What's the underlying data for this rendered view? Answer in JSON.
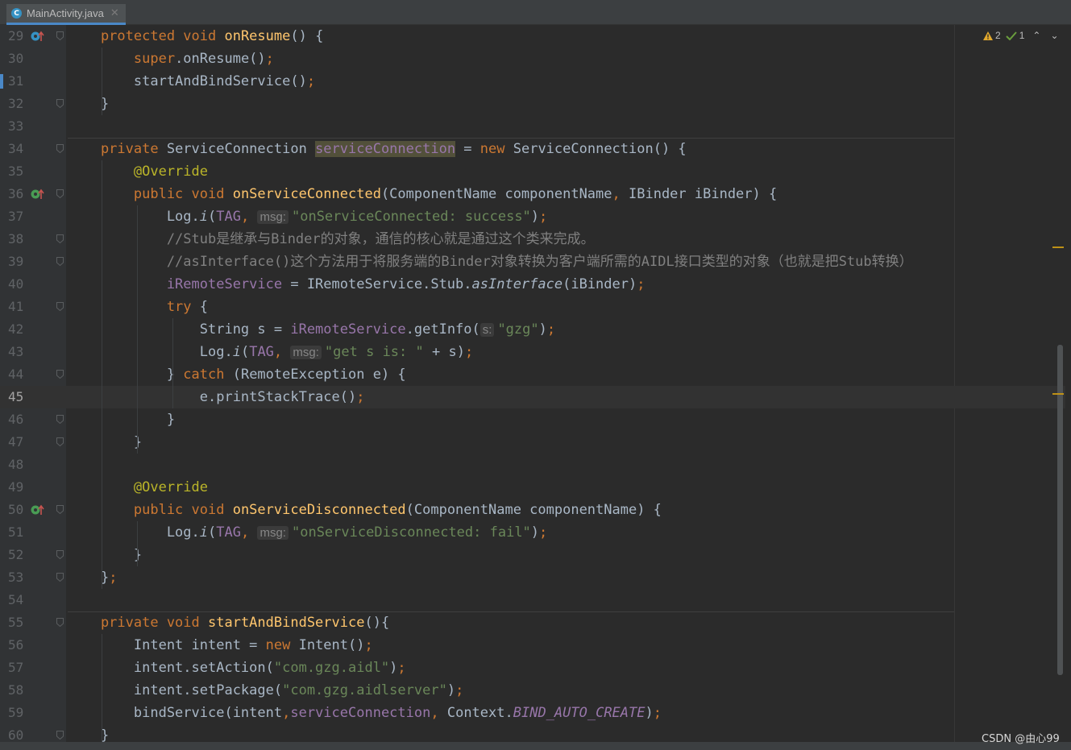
{
  "tab": {
    "title": "MainActivity.java",
    "icon": "java-class-icon",
    "accent": "#4a88c7"
  },
  "inspections": {
    "warnings": "2",
    "weak_warnings": "1"
  },
  "current_line": 45,
  "colors": {
    "keyword": "#cc7832",
    "function": "#ffc66d",
    "string": "#6a8759",
    "comment": "#808080",
    "field": "#9876aa",
    "annotation": "#bbb529",
    "text": "#a9b7c6"
  },
  "lines": [
    {
      "n": "29",
      "tokens": [
        [
          "kw",
          "    protected void "
        ],
        [
          "fn",
          "onResume"
        ],
        [
          "p",
          "() {"
        ]
      ]
    },
    {
      "n": "30",
      "tokens": [
        [
          "kw",
          "        super"
        ],
        [
          "p",
          ".onResume()"
        ],
        [
          "kw",
          ";"
        ]
      ]
    },
    {
      "n": "31",
      "tokens": [
        [
          "p",
          "        startAndBindService()"
        ],
        [
          "kw",
          ";"
        ]
      ]
    },
    {
      "n": "32",
      "tokens": [
        [
          "p",
          "    }"
        ]
      ]
    },
    {
      "n": "33",
      "tokens": []
    },
    {
      "n": "34",
      "tokens": [
        [
          "kw",
          "    private "
        ],
        [
          "p",
          "ServiceConnection "
        ],
        [
          "fldhl",
          "serviceConnection"
        ],
        [
          "p",
          " = "
        ],
        [
          "kw",
          "new "
        ],
        [
          "p",
          "ServiceConnection() {"
        ]
      ]
    },
    {
      "n": "35",
      "tokens": [
        [
          "ann",
          "        @Override"
        ]
      ]
    },
    {
      "n": "36",
      "tokens": [
        [
          "kw",
          "        public void "
        ],
        [
          "fn",
          "onServiceConnected"
        ],
        [
          "p",
          "(ComponentName componentName"
        ],
        [
          "kw",
          ", "
        ],
        [
          "p",
          "IBinder iBinder) {"
        ]
      ]
    },
    {
      "n": "37",
      "tokens": [
        [
          "p",
          "            Log."
        ],
        [
          "pit",
          "i"
        ],
        [
          "p",
          "("
        ],
        [
          "fld",
          "TAG"
        ],
        [
          "kw",
          ", "
        ],
        [
          "hint",
          "msg:"
        ],
        [
          "str",
          "\"onServiceConnected: success\""
        ],
        [
          "p",
          ")"
        ],
        [
          "kw",
          ";"
        ]
      ]
    },
    {
      "n": "38",
      "tokens": [
        [
          "cm",
          "            //Stub是继承与Binder的对象，通信的核心就是通过这个类来完成。"
        ]
      ]
    },
    {
      "n": "39",
      "tokens": [
        [
          "cm",
          "            //asInterface()这个方法用于将服务端的Binder对象转换为客户端所需的AIDL接口类型的对象（也就是把Stub转换）"
        ]
      ]
    },
    {
      "n": "40",
      "tokens": [
        [
          "fld",
          "            iRemoteService"
        ],
        [
          "p",
          " = IRemoteService.Stub."
        ],
        [
          "pit",
          "asInterface"
        ],
        [
          "p",
          "(iBinder)"
        ],
        [
          "kw",
          ";"
        ]
      ]
    },
    {
      "n": "41",
      "tokens": [
        [
          "kw",
          "            try "
        ],
        [
          "p",
          "{"
        ]
      ]
    },
    {
      "n": "42",
      "tokens": [
        [
          "p",
          "                String s = "
        ],
        [
          "fld",
          "iRemoteService"
        ],
        [
          "p",
          ".getInfo("
        ],
        [
          "hint",
          "s:"
        ],
        [
          "str",
          "\"gzg\""
        ],
        [
          "p",
          ")"
        ],
        [
          "kw",
          ";"
        ]
      ]
    },
    {
      "n": "43",
      "tokens": [
        [
          "p",
          "                Log."
        ],
        [
          "pit",
          "i"
        ],
        [
          "p",
          "("
        ],
        [
          "fld",
          "TAG"
        ],
        [
          "kw",
          ", "
        ],
        [
          "hint",
          "msg:"
        ],
        [
          "str",
          "\"get s is: \""
        ],
        [
          "p",
          " + s)"
        ],
        [
          "kw",
          ";"
        ]
      ]
    },
    {
      "n": "44",
      "tokens": [
        [
          "p",
          "            } "
        ],
        [
          "kw",
          "catch "
        ],
        [
          "p",
          "(RemoteException e) {"
        ]
      ]
    },
    {
      "n": "45",
      "tokens": [
        [
          "p",
          "                e.printStackTrace()"
        ],
        [
          "kw",
          ";"
        ]
      ]
    },
    {
      "n": "46",
      "tokens": [
        [
          "p",
          "            }"
        ]
      ]
    },
    {
      "n": "47",
      "tokens": [
        [
          "p",
          "        }"
        ]
      ]
    },
    {
      "n": "48",
      "tokens": []
    },
    {
      "n": "49",
      "tokens": [
        [
          "ann",
          "        @Override"
        ]
      ]
    },
    {
      "n": "50",
      "tokens": [
        [
          "kw",
          "        public void "
        ],
        [
          "fn",
          "onServiceDisconnected"
        ],
        [
          "p",
          "(ComponentName componentName) {"
        ]
      ]
    },
    {
      "n": "51",
      "tokens": [
        [
          "p",
          "            Log."
        ],
        [
          "pit",
          "i"
        ],
        [
          "p",
          "("
        ],
        [
          "fld",
          "TAG"
        ],
        [
          "kw",
          ", "
        ],
        [
          "hint",
          "msg:"
        ],
        [
          "str",
          "\"onServiceDisconnected: fail\""
        ],
        [
          "p",
          ")"
        ],
        [
          "kw",
          ";"
        ]
      ]
    },
    {
      "n": "52",
      "tokens": [
        [
          "p",
          "        }"
        ]
      ]
    },
    {
      "n": "53",
      "tokens": [
        [
          "p",
          "    }"
        ],
        [
          "kw",
          ";"
        ]
      ]
    },
    {
      "n": "54",
      "tokens": []
    },
    {
      "n": "55",
      "tokens": [
        [
          "kw",
          "    private void "
        ],
        [
          "fn",
          "startAndBindService"
        ],
        [
          "p",
          "(){"
        ]
      ]
    },
    {
      "n": "56",
      "tokens": [
        [
          "p",
          "        Intent intent = "
        ],
        [
          "kw",
          "new "
        ],
        [
          "p",
          "Intent()"
        ],
        [
          "kw",
          ";"
        ]
      ]
    },
    {
      "n": "57",
      "tokens": [
        [
          "p",
          "        intent.setAction("
        ],
        [
          "str",
          "\"com.gzg.aidl\""
        ],
        [
          "p",
          ")"
        ],
        [
          "kw",
          ";"
        ]
      ]
    },
    {
      "n": "58",
      "tokens": [
        [
          "p",
          "        intent.setPackage("
        ],
        [
          "str",
          "\"com.gzg.aidlserver\""
        ],
        [
          "p",
          ")"
        ],
        [
          "kw",
          ";"
        ]
      ]
    },
    {
      "n": "59",
      "tokens": [
        [
          "p",
          "        bindService(intent"
        ],
        [
          "kw",
          ","
        ],
        [
          "fld",
          "serviceConnection"
        ],
        [
          "kw",
          ", "
        ],
        [
          "p",
          "Context."
        ],
        [
          "fldit",
          "BIND_AUTO_CREATE"
        ],
        [
          "p",
          ")"
        ],
        [
          "kw",
          ";"
        ]
      ]
    },
    {
      "n": "60",
      "tokens": [
        [
          "p",
          "    }"
        ]
      ]
    }
  ],
  "gutter_icons": {
    "29": "override-method-icon",
    "36": "implement-method-icon",
    "50": "implement-method-icon"
  },
  "folds": [
    "29",
    "32",
    "34",
    "36",
    "38",
    "39",
    "41",
    "44",
    "46",
    "47",
    "50",
    "52",
    "53",
    "55",
    "60"
  ],
  "watermark": "CSDN @由心99"
}
